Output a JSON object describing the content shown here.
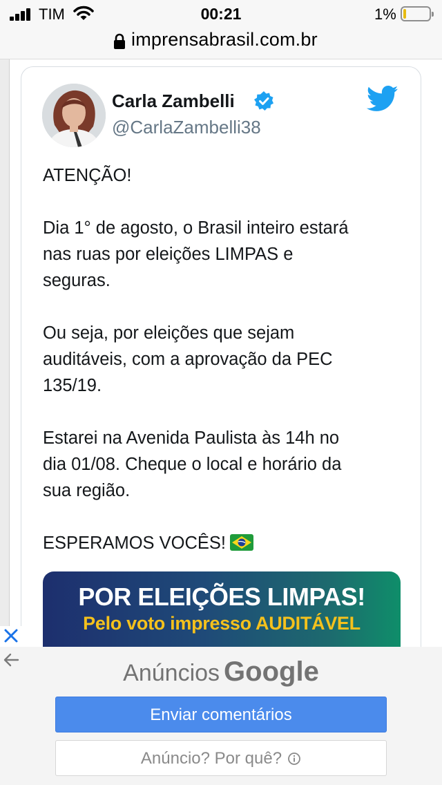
{
  "status_bar": {
    "carrier": "TIM",
    "time": "00:21",
    "battery_percent": "1%",
    "battery_level": 0.01
  },
  "browser": {
    "url": "imprensabrasil.com.br"
  },
  "tweet": {
    "display_name": "Carla Zambelli",
    "handle": "@CarlaZambelli38",
    "paragraphs": [
      "ATENÇÃO!",
      "Dia 1° de agosto, o Brasil inteiro estará\nnas ruas por eleições LIMPAS e\nseguras.",
      "Ou seja, por eleições que sejam\nauditáveis, com a aprovação da PEC\n135/19.",
      "Estarei na Avenida Paulista às 14h no\ndia 01/08. Cheque o local e horário da\nsua região.",
      "ESPERAMOS VOCÊS!"
    ],
    "image": {
      "title": "POR ELEIÇÕES LIMPAS!",
      "subtitle": "Pelo voto impresso AUDITÁVEL"
    }
  },
  "ad": {
    "label_prefix": "Anúncios",
    "label_brand": "Google",
    "feedback_button": "Enviar comentários",
    "why_button": "Anúncio? Por quê?"
  },
  "colors": {
    "twitter_blue": "#1da1f2",
    "feedback_button": "#4b8bec",
    "ad_close": "#1a73e8"
  },
  "icons": [
    "signal-icon",
    "wifi-icon",
    "battery-icon",
    "lock-icon",
    "verified-icon",
    "twitter-bird-icon",
    "brazil-flag-icon",
    "close-icon",
    "back-arrow-icon",
    "info-icon"
  ]
}
